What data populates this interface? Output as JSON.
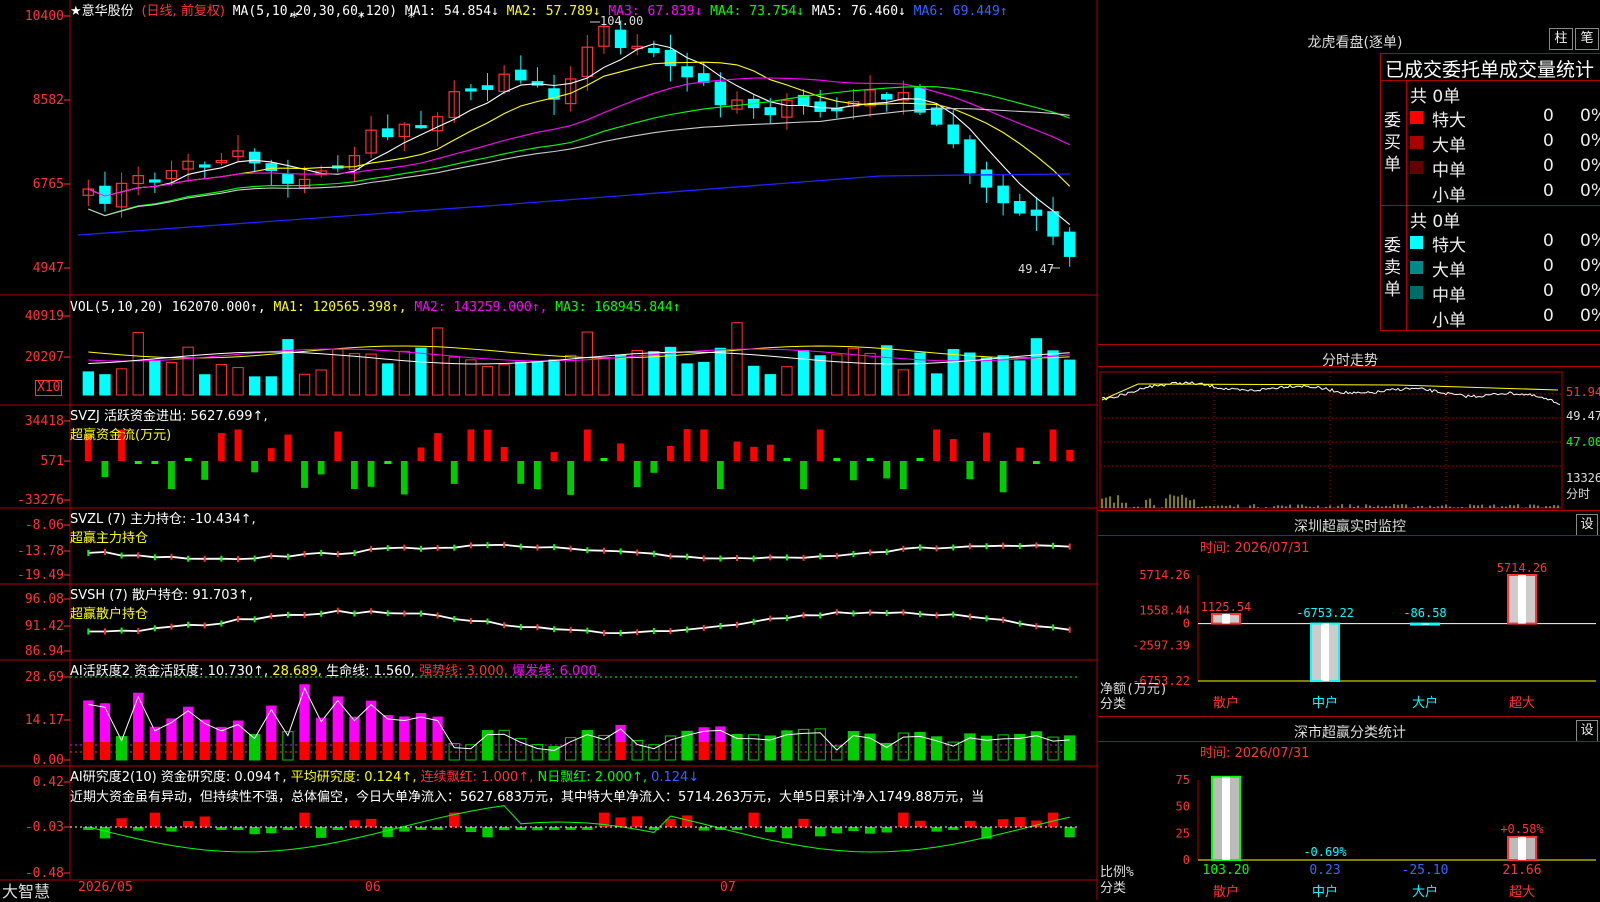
{
  "main": {
    "title": "★意华股份",
    "mode": "(日线, 前复权)",
    "ma_items": [
      {
        "label": "MA(5,10,20,30,60,120)",
        "color": "#ffffff"
      },
      {
        "label": "MA1: 54.854↓",
        "color": "#ffffff"
      },
      {
        "label": "MA2: 57.789↓",
        "color": "#ffff00"
      },
      {
        "label": "MA3: 67.839↓",
        "color": "#ff00ff"
      },
      {
        "label": "MA4: 73.754↓",
        "color": "#00ff00"
      },
      {
        "label": "MA5: 76.460↓",
        "color": "#ffffff"
      },
      {
        "label": "MA6: 69.449↑",
        "color": "#3366ff"
      }
    ],
    "y_ticks": [
      "10400",
      "8582",
      "6765",
      "4947"
    ],
    "high_label": "104.00",
    "low_label": "49.47"
  },
  "vol": {
    "items": [
      {
        "label": "VOL(5,10,20)",
        "color": "#ffffff"
      },
      {
        "label": "162070.000↑,",
        "color": "#ffffff"
      },
      {
        "label": "MA1: 120565.398↑,",
        "color": "#ffff00"
      },
      {
        "label": "MA2: 143259.000↑,",
        "color": "#ff00ff"
      },
      {
        "label": "MA3: 168945.844↑",
        "color": "#00ff00"
      }
    ],
    "y_ticks": [
      "40919",
      "20207"
    ],
    "unit": "X10"
  },
  "svzj": {
    "line1": "SVZJ  活跃资金进出: 5627.699↑,",
    "line2": "超赢资金流(万元)",
    "y_ticks": [
      "34418",
      "571",
      "-33276"
    ]
  },
  "svzl": {
    "line1": "SVZL (7) 主力持仓: -10.434↑,",
    "line2": "超赢主力持仓",
    "y_ticks": [
      "-8.06",
      "-13.78",
      "-19.49"
    ]
  },
  "svsh": {
    "line1": "SVSH (7) 散户持仓: 91.703↑,",
    "line2": "超赢散户持仓",
    "y_ticks": [
      "96.08",
      "91.42",
      "86.94"
    ]
  },
  "ai1": {
    "items": [
      {
        "label": "AI活跃度2 资金活跃度: 10.730↑,",
        "color": "#ffffff"
      },
      {
        "label": "28.689,",
        "color": "#ffff00"
      },
      {
        "label": "生命线: 1.560,",
        "color": "#ffffff"
      },
      {
        "label": "强势线: 3.000,",
        "color": "#ff3333"
      },
      {
        "label": "爆发线: 6.000,",
        "color": "#ff00ff"
      }
    ],
    "y_ticks": [
      "28.69",
      "14.17",
      "0.00"
    ]
  },
  "ai2": {
    "items": [
      {
        "label": "AI研究度2(10) 资金研究度: 0.094↑,",
        "color": "#ffffff"
      },
      {
        "label": "平均研究度: 0.124↑,",
        "color": "#ffff00"
      },
      {
        "label": "连续飘红: 1.000↑,",
        "color": "#ff3333"
      },
      {
        "label": "N日飘红: 2.000↑,",
        "color": "#00ff00"
      },
      {
        "label": "0.124↓",
        "color": "#3366ff"
      }
    ],
    "comment": "近期大资金虽有异动，但持续性不强，总体偏空，今日大单净流入：5627.683万元，其中特大单净流入：5714.263万元，大单5日累计净入1749.88万元，当",
    "y_ticks": [
      "0.42",
      "-0.03",
      "-0.48"
    ]
  },
  "xaxis": {
    "labels": [
      "2026/05",
      "06",
      "07"
    ]
  },
  "brand": "大智慧",
  "lhb": {
    "title": "龙虎看盘(逐单)",
    "buttons": [
      "柱",
      "笔"
    ],
    "tabs_text": "已成交委托单成交量统计",
    "buy": {
      "side_label": "委买单",
      "total": "共 0单",
      "rows": [
        {
          "name": "特大",
          "v": "0",
          "p": "0%",
          "color": "#ff0000"
        },
        {
          "name": "大单",
          "v": "0",
          "p": "0%",
          "color": "#aa0000"
        },
        {
          "name": "中单",
          "v": "0",
          "p": "0%",
          "color": "#660000"
        },
        {
          "name": "小单",
          "v": "0",
          "p": "0%",
          "color": ""
        }
      ]
    },
    "sell": {
      "side_label": "委卖单",
      "total": "共 0单",
      "rows": [
        {
          "name": "特大",
          "v": "0",
          "p": "0%",
          "color": "#00ffff"
        },
        {
          "name": "大单",
          "v": "0",
          "p": "0%",
          "color": "#008b8b"
        },
        {
          "name": "中单",
          "v": "0",
          "p": "0%",
          "color": "#006b6b"
        },
        {
          "name": "小单",
          "v": "0",
          "p": "0%",
          "color": ""
        }
      ]
    }
  },
  "intraday": {
    "title": "分时走势",
    "right_labels": [
      "51.94",
      "49.47",
      "47.00",
      "13326",
      "分时"
    ]
  },
  "monitor": {
    "title": "深圳超赢实时监控",
    "set": "设",
    "time": "时间: 2026/07/31",
    "y_ticks": [
      "5714.26",
      "1558.44",
      "0",
      "-2597.39",
      "-6753.22"
    ],
    "y_label": "净额(万元)",
    "x_label": "分类",
    "cats": [
      "散户",
      "中户",
      "大户",
      "超大"
    ],
    "values": [
      1125.54,
      -6753.22,
      -86.58,
      5714.26
    ],
    "value_labels": [
      "1125.54",
      "-6753.22",
      "-86.58",
      "5714.26"
    ]
  },
  "classify": {
    "title": "深市超赢分类统计",
    "set": "设",
    "time": "时间: 2026/07/31",
    "y_ticks": [
      "75",
      "50",
      "25",
      "0"
    ],
    "y_label": "比例%",
    "x_label": "分类",
    "cats": [
      "散户",
      "中户",
      "大户",
      "超大"
    ],
    "pct_labels": [
      "",
      "-0.69%",
      "",
      "+0.58%"
    ],
    "bottom_values": [
      "103.20",
      "0.23",
      "-25.10",
      "21.66"
    ]
  },
  "chart_data": [
    {
      "type": "candlestick",
      "name": "意华股份 日线",
      "x": [
        "2026/05",
        "06",
        "07"
      ],
      "ylim": [
        4947,
        10400
      ],
      "y_ticks": [
        4947,
        6765,
        8582,
        10400
      ],
      "annotations": [
        {
          "label": "104.00"
        },
        {
          "label": "49.47"
        }
      ],
      "series": [
        {
          "name": "MA1",
          "last": 54.854
        },
        {
          "name": "MA2",
          "last": 57.789
        },
        {
          "name": "MA3",
          "last": 67.839
        },
        {
          "name": "MA4",
          "last": 73.754
        },
        {
          "name": "MA5",
          "last": 76.46
        },
        {
          "name": "MA6",
          "last": 69.449
        }
      ]
    },
    {
      "type": "bar",
      "name": "VOL(5,10,20)",
      "ylim": [
        0,
        40919
      ],
      "last_value": 162070.0,
      "series": [
        {
          "name": "MA1",
          "last": 120565.398
        },
        {
          "name": "MA2",
          "last": 143259.0
        },
        {
          "name": "MA3",
          "last": 168945.844
        }
      ]
    },
    {
      "type": "bar",
      "name": "超赢资金流(万元)",
      "ylim": [
        -33276,
        34418
      ],
      "last_value": 5627.699
    },
    {
      "type": "bar",
      "name": "深圳超赢实时监控",
      "categories": [
        "散户",
        "中户",
        "大户",
        "超大"
      ],
      "values": [
        1125.54,
        -6753.22,
        -86.58,
        5714.26
      ],
      "ylim": [
        -6753.22,
        5714.26
      ],
      "ylabel": "净额(万元)",
      "xlabel": "分类"
    },
    {
      "type": "bar",
      "name": "深市超赢分类统计",
      "categories": [
        "散户",
        "中户",
        "大户",
        "超大"
      ],
      "values": [
        103.2,
        0.23,
        -25.1,
        21.66
      ],
      "ylim": [
        0,
        75
      ],
      "ylabel": "比例%",
      "xlabel": "分类"
    }
  ]
}
